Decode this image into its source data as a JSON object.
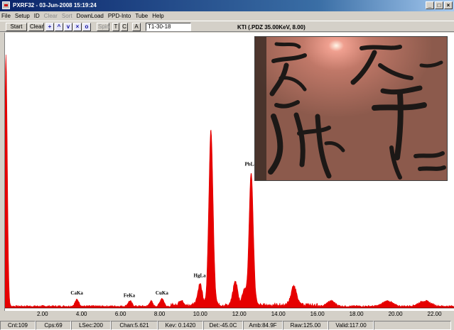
{
  "window": {
    "title": "PXRF32 - 03-Jun-2008 15:19:24"
  },
  "menu": [
    "File",
    "Setup",
    "ID",
    "Clear",
    "Sort",
    "DownLoad",
    "PPD-Into",
    "Tube",
    "Help"
  ],
  "toolbar": {
    "start_label": "Start",
    "clear_label": "Clear",
    "spin_label": "Spin",
    "t_label": "T",
    "c_label": "C",
    "a_label": "A",
    "sample_id": "T1-30-18",
    "instrument": "KTI  (.PDZ 35.00KeV, 8.00)"
  },
  "chart_data": {
    "type": "line",
    "title": "",
    "xlabel": "",
    "ylabel": "",
    "xlim": [
      0,
      23.0
    ],
    "x_ticks": [
      "2.00",
      "4.00",
      "6.00",
      "8.00",
      "10.00",
      "12.00",
      "14.00",
      "16.00",
      "18.00",
      "20.00",
      "22.00"
    ],
    "x_tick_values": [
      2,
      4,
      6,
      8,
      10,
      12,
      14,
      16,
      18,
      20,
      22
    ],
    "peaks": [
      {
        "x": 0.05,
        "height": 0.95,
        "width": 0.07
      },
      {
        "x": 3.69,
        "height": 0.025,
        "width": 0.1
      },
      {
        "x": 6.4,
        "height": 0.02,
        "width": 0.1
      },
      {
        "x": 7.48,
        "height": 0.02,
        "width": 0.08
      },
      {
        "x": 8.04,
        "height": 0.03,
        "width": 0.1
      },
      {
        "x": 9.0,
        "height": 0.02,
        "width": 0.1
      },
      {
        "x": 9.99,
        "height": 0.08,
        "width": 0.12
      },
      {
        "x": 10.55,
        "height": 0.66,
        "width": 0.11
      },
      {
        "x": 11.8,
        "height": 0.09,
        "width": 0.12
      },
      {
        "x": 12.25,
        "height": 0.06,
        "width": 0.1
      },
      {
        "x": 12.61,
        "height": 0.5,
        "width": 0.11
      },
      {
        "x": 14.8,
        "height": 0.07,
        "width": 0.15
      },
      {
        "x": 16.7,
        "height": 0.02,
        "width": 0.2
      },
      {
        "x": 19.6,
        "height": 0.02,
        "width": 0.25
      },
      {
        "x": 21.5,
        "height": 0.02,
        "width": 0.3
      }
    ],
    "peak_labels": [
      {
        "text": "CaKa",
        "x": 3.69,
        "height": 0.035
      },
      {
        "text": "FeKa",
        "x": 6.4,
        "height": 0.025
      },
      {
        "text": "CuKa",
        "x": 8.04,
        "height": 0.035
      },
      {
        "text": "HgLa",
        "x": 9.99,
        "height": 0.1
      },
      {
        "text": "PbLa",
        "x": 12.61,
        "height": 0.52
      }
    ],
    "grid": false,
    "color": "#e60000"
  },
  "status": {
    "cnt": "Cnt:109",
    "cps": "Cps:69",
    "lsec": "LSec:200",
    "chan": "Chan:5.621",
    "kev": "Kev: 0.1420",
    "det": "Det:-45.0C",
    "amb": "Amb:84.9F",
    "raw": "Raw:125.00",
    "valid": "Valid:117.00"
  },
  "colors": {
    "spectrum": "#e60000",
    "titlebar": "#0a246a"
  }
}
